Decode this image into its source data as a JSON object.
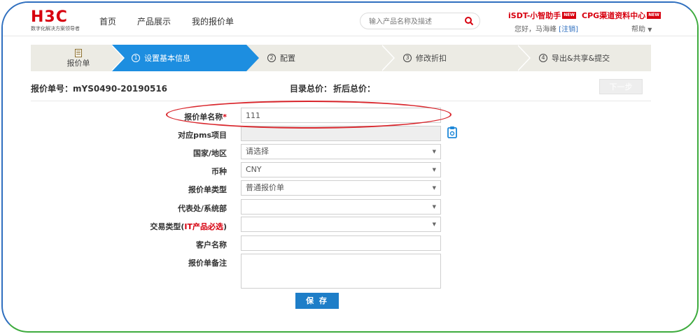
{
  "header": {
    "logo_text": "H3C",
    "logo_tagline": "数字化解决方案领导者",
    "nav": [
      "首页",
      "产品展示",
      "我的报价单"
    ],
    "search_placeholder": "输入产品名称及描述",
    "ext_links": [
      {
        "label": "iSDT-小智助手",
        "badge": "NEW"
      },
      {
        "label": "CPG渠道资料中心",
        "badge": "NEW"
      }
    ],
    "greeting": "您好，马海峰",
    "logout": "[注销]",
    "help": "帮助"
  },
  "steps": {
    "first": "报价单",
    "items": [
      {
        "num": "1",
        "label": "设置基本信息",
        "active": true
      },
      {
        "num": "2",
        "label": "配置",
        "active": false
      },
      {
        "num": "3",
        "label": "修改折扣",
        "active": false
      },
      {
        "num": "4",
        "label": "导出&共享&提交",
        "active": false
      }
    ]
  },
  "info": {
    "quote_no_label": "报价单号：",
    "quote_no": "mYS0490-20190516",
    "list_total_label": "目录总价：",
    "discount_total_label": "折后总价：",
    "next_button": "下一步"
  },
  "form": {
    "name_label": "报价单名称",
    "required_mark": "*",
    "name_value": "111",
    "pms_label": "对应pms项目",
    "pms_value": "",
    "country_label": "国家/地区",
    "country_value": "请选择",
    "currency_label": "币种",
    "currency_value": "CNY",
    "type_label": "报价单类型",
    "type_value": "普通报价单",
    "office_label": "代表处/系统部",
    "office_value": "",
    "trade_label_prefix": "交易类型(",
    "trade_label_red": "IT产品必选",
    "trade_label_suffix": ")",
    "trade_value": "",
    "customer_label": "客户名称",
    "customer_value": "",
    "remark_label": "报价单备注",
    "remark_value": "",
    "save_button": "保 存"
  },
  "colors": {
    "brand_red": "#d7000f",
    "step_active": "#1d8ee0",
    "save_blue": "#1e7ec8",
    "highlight": "#d9262c"
  }
}
